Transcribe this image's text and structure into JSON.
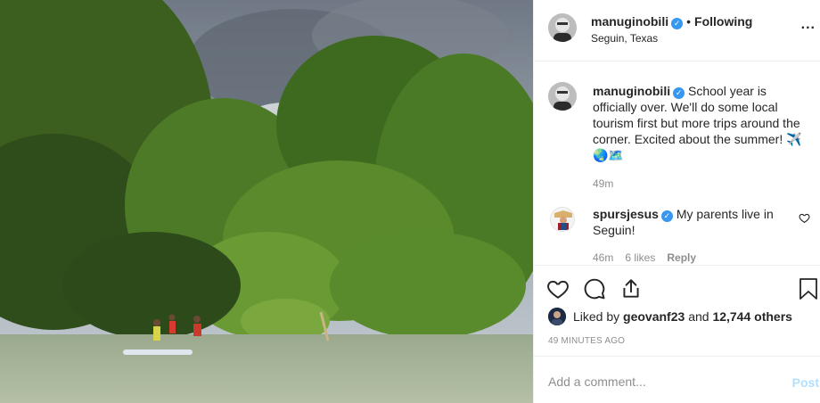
{
  "post": {
    "photo": {
      "alt": "Photo by manuginobili"
    },
    "header": {
      "username": "manuginobili",
      "verified_icon": "verified-check-icon",
      "separator": "•",
      "follow_state": "Following",
      "location": "Seguin, Texas",
      "more_icon": "more-options-icon",
      "more_label": "..."
    },
    "caption": {
      "username": "manuginobili",
      "text": "School year is officially over. We'll do some local tourism first but more trips around the corner. Excited about the summer! ✈️ 🌏🗺️",
      "time": "49m"
    },
    "reply": {
      "username": "spursjesus",
      "text": "My parents live in Seguin!",
      "time": "46m",
      "likes": "6 likes",
      "reply_label": "Reply"
    },
    "actions": {
      "like_icon": "heart-icon",
      "comment_icon": "comment-icon",
      "share_icon": "share-icon",
      "save_icon": "bookmark-icon"
    },
    "likes": {
      "prefix": "Liked by",
      "user": "geovanf23",
      "conj": "and",
      "others": "12,744 others"
    },
    "timestamp": "49 minutes ago",
    "add_comment": {
      "placeholder": "Add a comment...",
      "post_label": "Post"
    },
    "colors": {
      "verified": "#3897f0",
      "post_disabled": "#b2dffc",
      "muted": "#8e8e8e"
    }
  }
}
